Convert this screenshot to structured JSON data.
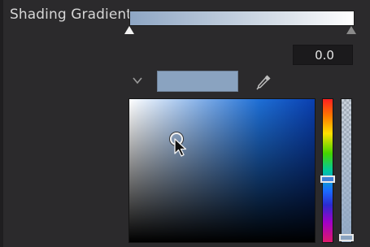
{
  "gradient": {
    "label": "Shading Gradient",
    "start_color": "#8ea6c4",
    "end_color": "#ffffff",
    "stops": [
      {
        "color": "#f2f2f2",
        "selected": true
      },
      {
        "color": "#8a8a8a",
        "selected": false
      }
    ]
  },
  "stop_position": {
    "value": "0.0"
  },
  "color_picker": {
    "current_color": "#8aa3c0",
    "expand_icon": "chevron-down-icon",
    "eyedropper_icon": "eyedropper-icon",
    "hue_color": "#1e6fd6",
    "hue_level": 0.55,
    "alpha_level": 1.0
  }
}
